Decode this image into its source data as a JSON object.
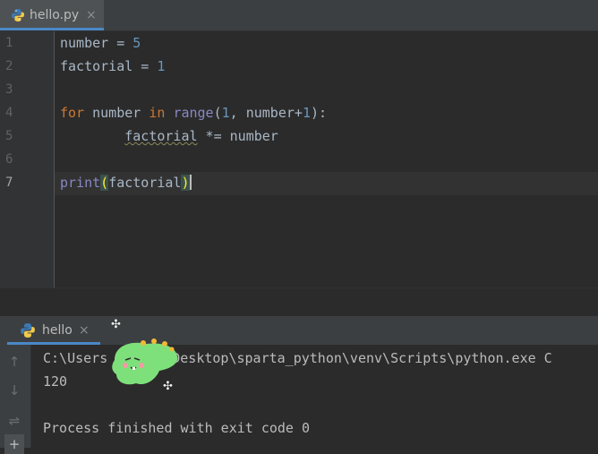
{
  "editor_tab": {
    "filename": "hello.py",
    "close": "×"
  },
  "gutter": {
    "lines": [
      "1",
      "2",
      "3",
      "4",
      "5",
      "6",
      "7"
    ],
    "active": "7"
  },
  "code": {
    "l1": {
      "var": "number",
      "op": " = ",
      "val": "5"
    },
    "l2": {
      "var": "factorial",
      "op": " = ",
      "val": "1"
    },
    "l4": {
      "for": "for",
      "a": " number ",
      "in": "in",
      "sp": " ",
      "range": "range",
      "open": "(",
      "one": "1",
      "mid": ", number+",
      "one2": "1",
      "close": "):"
    },
    "l5": {
      "indent": "        ",
      "var": "factorial",
      "rest": " *= number"
    },
    "l7": {
      "print": "print",
      "open": "(",
      "arg": "factorial",
      "close": ")"
    }
  },
  "run_tab": {
    "label": "hello",
    "close": "×"
  },
  "run_toolbar": {
    "up": "↑",
    "down": "↓",
    "wrap": "⇌",
    "pin": "+"
  },
  "console": {
    "cmd": "C:\\Users",
    "cmd_rest": "Desktop\\sparta_python\\venv\\Scripts\\python.exe C",
    "output": "120",
    "finished": "Process finished with exit code 0"
  },
  "colors": {
    "background": "#2b2b2b",
    "keyword": "#cc7832",
    "number": "#6897bb",
    "builtin": "#8888c6",
    "text": "#a9b7c6",
    "accent": "#4a88c7"
  }
}
